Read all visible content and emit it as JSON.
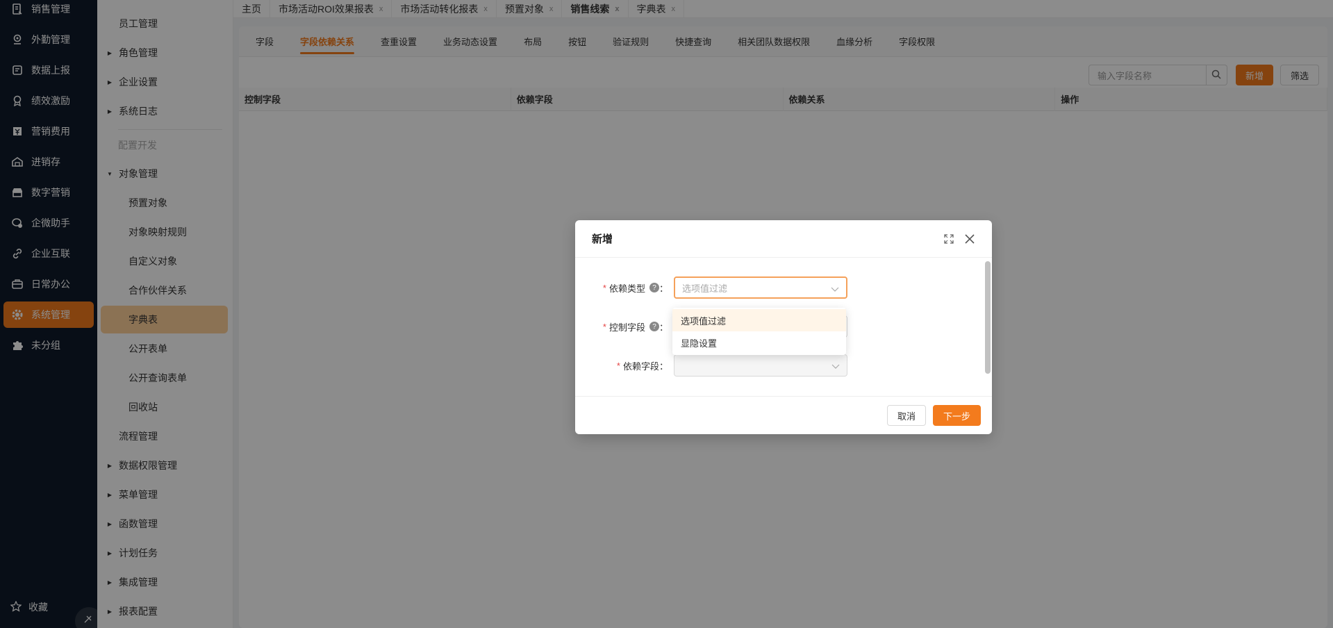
{
  "nav": {
    "items": [
      {
        "label": "销售管理",
        "icon": "sales-icon"
      },
      {
        "label": "外勤管理",
        "icon": "field-icon"
      },
      {
        "label": "数据上报",
        "icon": "report-icon"
      },
      {
        "label": "绩效激励",
        "icon": "medal-icon"
      },
      {
        "label": "营销费用",
        "icon": "expense-icon"
      },
      {
        "label": "进销存",
        "icon": "warehouse-icon"
      },
      {
        "label": "数字营销",
        "icon": "store-icon"
      },
      {
        "label": "企微助手",
        "icon": "wechat-icon"
      },
      {
        "label": "企业互联",
        "icon": "link-icon"
      },
      {
        "label": "日常办公",
        "icon": "briefcase-icon"
      },
      {
        "label": "系统管理",
        "icon": "gear-icon"
      },
      {
        "label": "未分组",
        "icon": "puzzle-icon"
      }
    ],
    "favorites": "收藏"
  },
  "submenu": {
    "items": [
      "员工管理",
      "角色管理",
      "企业设置",
      "系统日志",
      "对象管理",
      "预置对象",
      "对象映射规则",
      "自定义对象",
      "合作伙伴关系",
      "字典表",
      "公开表单",
      "公开查询表单",
      "回收站",
      "流程管理",
      "数据权限管理",
      "菜单管理",
      "函数管理",
      "计划任务",
      "集成管理",
      "报表配置"
    ],
    "group": "配置开发"
  },
  "tabs": [
    {
      "label": "主页"
    },
    {
      "label": "市场活动ROI效果报表"
    },
    {
      "label": "市场活动转化报表"
    },
    {
      "label": "预置对象"
    },
    {
      "label": "销售线索"
    },
    {
      "label": "字典表"
    }
  ],
  "subtabs": [
    "字段",
    "字段依赖关系",
    "查重设置",
    "业务动态设置",
    "布局",
    "按钮",
    "验证规则",
    "快捷查询",
    "相关团队数据权限",
    "血缘分析",
    "字段权限"
  ],
  "toolbar": {
    "search_placeholder": "输入字段名称",
    "new": "新增",
    "filter": "筛选"
  },
  "table": {
    "headers": [
      "控制字段",
      "依赖字段",
      "依赖关系",
      "操作"
    ]
  },
  "modal": {
    "title": "新增",
    "fields": [
      {
        "label": "依赖类型",
        "value": "选项值过滤"
      },
      {
        "label": "控制字段",
        "value": ""
      },
      {
        "label": "依赖字段",
        "value": ""
      }
    ],
    "dropdown": [
      "选项值过滤",
      "显隐设置"
    ],
    "cancel": "取消",
    "next": "下一步"
  },
  "colors": {
    "accent": "#f37b1d",
    "nav_bg": "#0f1a2a",
    "active_menu": "#fdcf99"
  }
}
